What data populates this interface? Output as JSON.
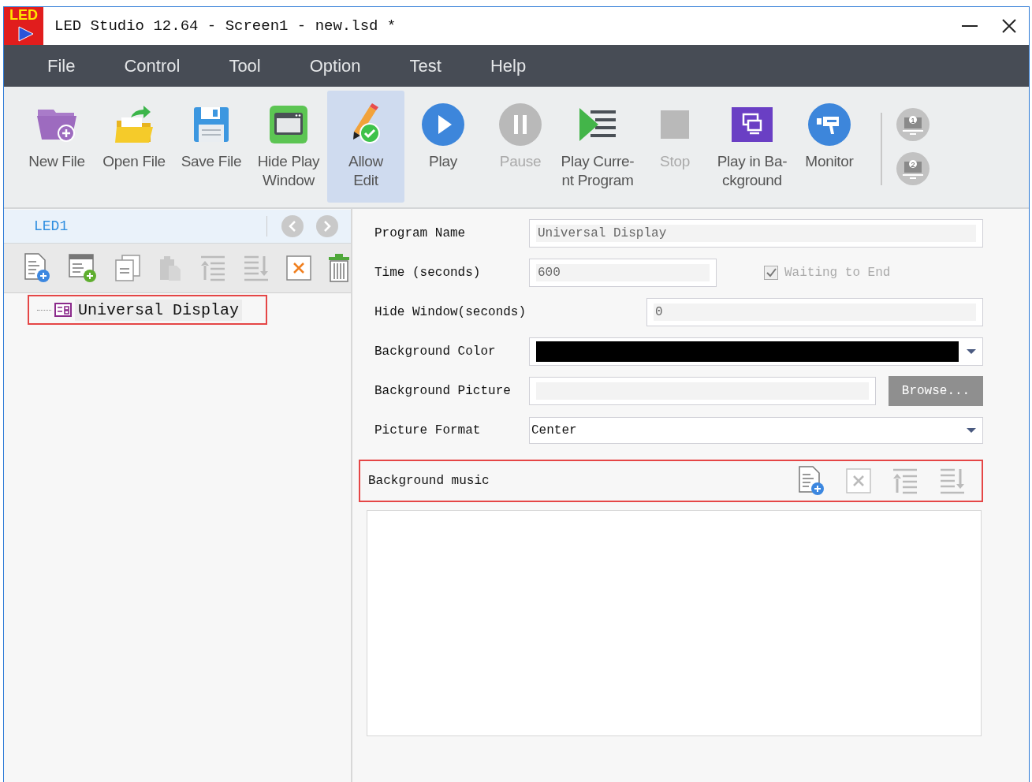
{
  "window": {
    "logo_text": "LED",
    "title": "LED Studio 12.64 - Screen1 - new.lsd *"
  },
  "menu": [
    "File",
    "Control",
    "Tool",
    "Option",
    "Test",
    "Help"
  ],
  "toolbar": [
    {
      "kind": "new-file",
      "label": "New File",
      "disabled": false,
      "selected": false
    },
    {
      "kind": "open-file",
      "label": "Open File",
      "disabled": false,
      "selected": false
    },
    {
      "kind": "save-file",
      "label": "Save File",
      "disabled": false,
      "selected": false
    },
    {
      "kind": "window",
      "label": "Hide Play\nWindow",
      "disabled": false,
      "selected": false
    },
    {
      "kind": "edit",
      "label": "Allow\nEdit",
      "disabled": false,
      "selected": true
    },
    {
      "kind": "play",
      "label": "Play",
      "disabled": false,
      "selected": false
    },
    {
      "kind": "pause",
      "label": "Pause",
      "disabled": true,
      "selected": false
    },
    {
      "kind": "play-list",
      "label": "Play Curre-\nnt Program",
      "disabled": false,
      "selected": false
    },
    {
      "kind": "stop",
      "label": "Stop",
      "disabled": true,
      "selected": false
    },
    {
      "kind": "background",
      "label": "Play in Ba-\nckground",
      "disabled": false,
      "selected": false
    },
    {
      "kind": "monitor",
      "label": "Monitor",
      "disabled": false,
      "selected": false
    }
  ],
  "screens": [
    {
      "label": "1"
    },
    {
      "label": "2"
    }
  ],
  "tree_panel": {
    "screen_tab": "LED1",
    "tools": [
      {
        "kind": "new-page",
        "disabled": false
      },
      {
        "kind": "new-window",
        "disabled": false
      },
      {
        "kind": "copy",
        "disabled": false
      },
      {
        "kind": "paste",
        "disabled": true
      },
      {
        "kind": "move-up",
        "disabled": true
      },
      {
        "kind": "move-down",
        "disabled": true
      },
      {
        "kind": "delete",
        "disabled": false
      },
      {
        "kind": "trash",
        "disabled": false
      }
    ],
    "items": [
      {
        "label": "Universal Display",
        "selected": true
      }
    ]
  },
  "properties": {
    "fields": [
      {
        "kind": "text",
        "label": "Program Name",
        "value": "Universal Display"
      },
      {
        "kind": "number",
        "label": "Time (seconds)",
        "value": "600",
        "checkbox": {
          "label": "Waiting to End",
          "checked": true
        }
      },
      {
        "kind": "short",
        "label": "Hide Window(seconds)",
        "value": "0"
      },
      {
        "kind": "color",
        "label": "Background Color",
        "color": "#000000"
      },
      {
        "kind": "file",
        "label": "Background Picture",
        "button": {
          "label": "Browse...",
          "disabled": true
        }
      },
      {
        "kind": "select",
        "label": "Picture Format",
        "value": "Center"
      }
    ],
    "music": {
      "label": "Background music",
      "highlighted": true,
      "tools": [
        {
          "kind": "add-file",
          "disabled": false
        },
        {
          "kind": "delete",
          "disabled": true
        },
        {
          "kind": "move-up",
          "disabled": true
        },
        {
          "kind": "move-down",
          "disabled": true
        }
      ]
    }
  }
}
